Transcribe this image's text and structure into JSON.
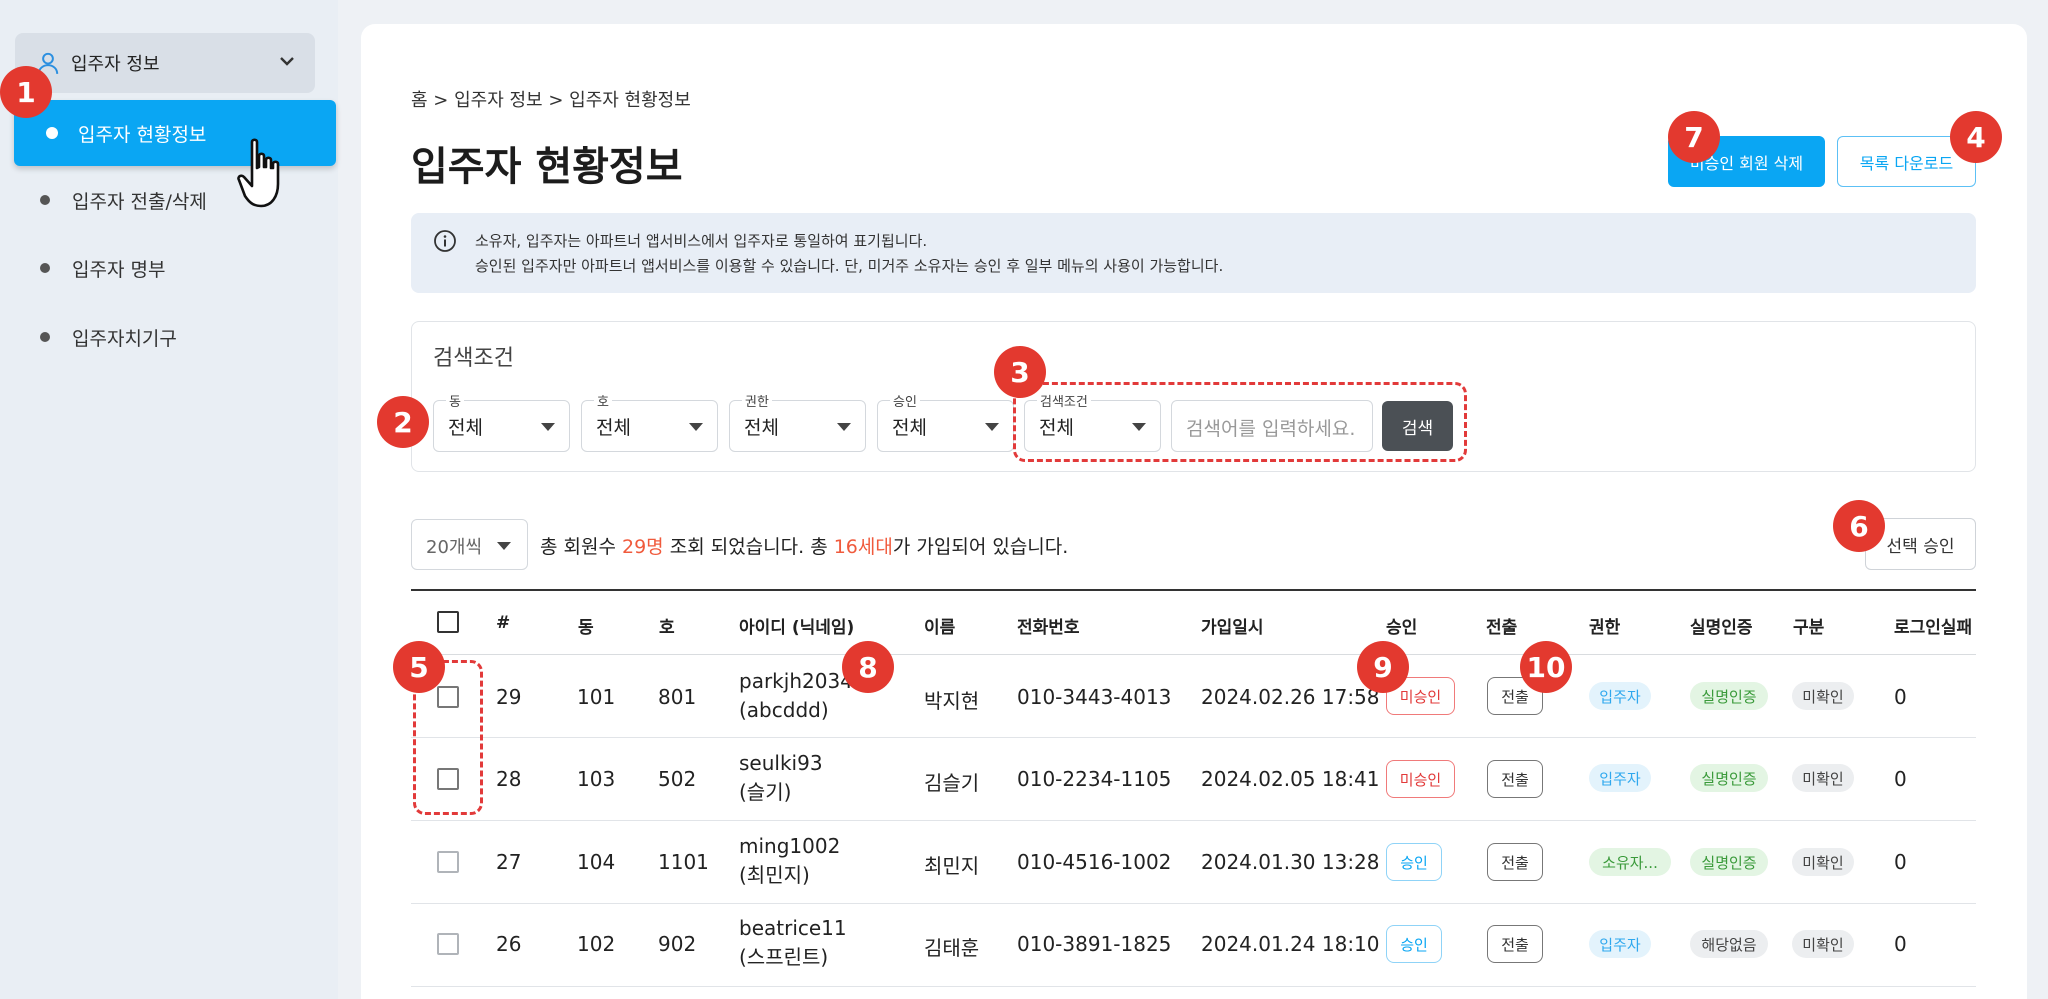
{
  "sidebar": {
    "group_label": "입주자 정보",
    "items": [
      {
        "label": "입주자 현황정보",
        "active": true
      },
      {
        "label": "입주자 전출/삭제"
      },
      {
        "label": "입주자 명부"
      },
      {
        "label": "입주자치기구"
      }
    ]
  },
  "breadcrumb": "홈 > 입주자 정보 > 입주자 현황정보",
  "page_title": "입주자 현황정보",
  "actions": {
    "delete_unapproved": "미승인 회원 삭제",
    "download_list": "목록 다운로드"
  },
  "notice": {
    "line1": "소유자, 입주자는 아파트너 앱서비스에서 입주자로 통일하여 표기됩니다.",
    "line2": "승인된 입주자만 아파트너 앱서비스를 이용할 수 있습니다. 단, 미거주 소유자는 승인 후 일부 메뉴의 사용이 가능합니다."
  },
  "search": {
    "title": "검색조건",
    "filters": [
      {
        "label": "동",
        "value": "전체"
      },
      {
        "label": "호",
        "value": "전체"
      },
      {
        "label": "권한",
        "value": "전체"
      },
      {
        "label": "승인",
        "value": "전체"
      },
      {
        "label": "검색조건",
        "value": "전체"
      }
    ],
    "placeholder": "검색어를 입력하세요.",
    "button": "검색"
  },
  "list": {
    "per_page": "20개씩",
    "summary_a": "총 회원수 ",
    "member_count": "29명",
    "summary_b": " 조회 되었습니다.  총 ",
    "household_count": "16세대",
    "summary_c": "가 가입되어 있습니다.",
    "select_approve": "선택 승인"
  },
  "table": {
    "headers": [
      "#",
      "동",
      "호",
      "아이디 (닉네임)",
      "이름",
      "전화번호",
      "가입일시",
      "승인",
      "전출",
      "권한",
      "실명인증",
      "구분",
      "로그인실패"
    ],
    "rows": [
      {
        "no": "29",
        "dong": "101",
        "ho": "801",
        "id": "parkjh2034",
        "nick": "(abcddd)",
        "name": "박지현",
        "phone": "010-3443-4013",
        "joined": "2024.02.26 17:58",
        "approval": "미승인",
        "approved": false,
        "exit": "전출",
        "role": "입주자",
        "verify": "실명인증",
        "verified": true,
        "type": "미확인",
        "fails": "0"
      },
      {
        "no": "28",
        "dong": "103",
        "ho": "502",
        "id": "seulki93",
        "nick": "(슬기)",
        "name": "김슬기",
        "phone": "010-2234-1105",
        "joined": "2024.02.05 18:41",
        "approval": "미승인",
        "approved": false,
        "exit": "전출",
        "role": "입주자",
        "verify": "실명인증",
        "verified": true,
        "type": "미확인",
        "fails": "0"
      },
      {
        "no": "27",
        "dong": "104",
        "ho": "1101",
        "id": "ming1002",
        "nick": "(최민지)",
        "name": "최민지",
        "phone": "010-4516-1002",
        "joined": "2024.01.30 13:28",
        "approval": "승인",
        "approved": true,
        "exit": "전출",
        "role": "소유자...",
        "verify": "실명인증",
        "verified": true,
        "type": "미확인",
        "fails": "0"
      },
      {
        "no": "26",
        "dong": "102",
        "ho": "902",
        "id": "beatrice11",
        "nick": "(스프린트)",
        "name": "김태훈",
        "phone": "010-3891-1825",
        "joined": "2024.01.24 18:10",
        "approval": "승인",
        "approved": true,
        "exit": "전출",
        "role": "입주자",
        "verify": "해당없음",
        "verified": false,
        "type": "미확인",
        "fails": "0"
      }
    ]
  },
  "annotations": [
    "1",
    "2",
    "3",
    "4",
    "5",
    "6",
    "7",
    "8",
    "9",
    "10"
  ],
  "colors": {
    "accent": "#0aa6f3",
    "badge": "#e3392f",
    "count_highlight": "#f05a3c",
    "search_button": "#4b5055"
  }
}
